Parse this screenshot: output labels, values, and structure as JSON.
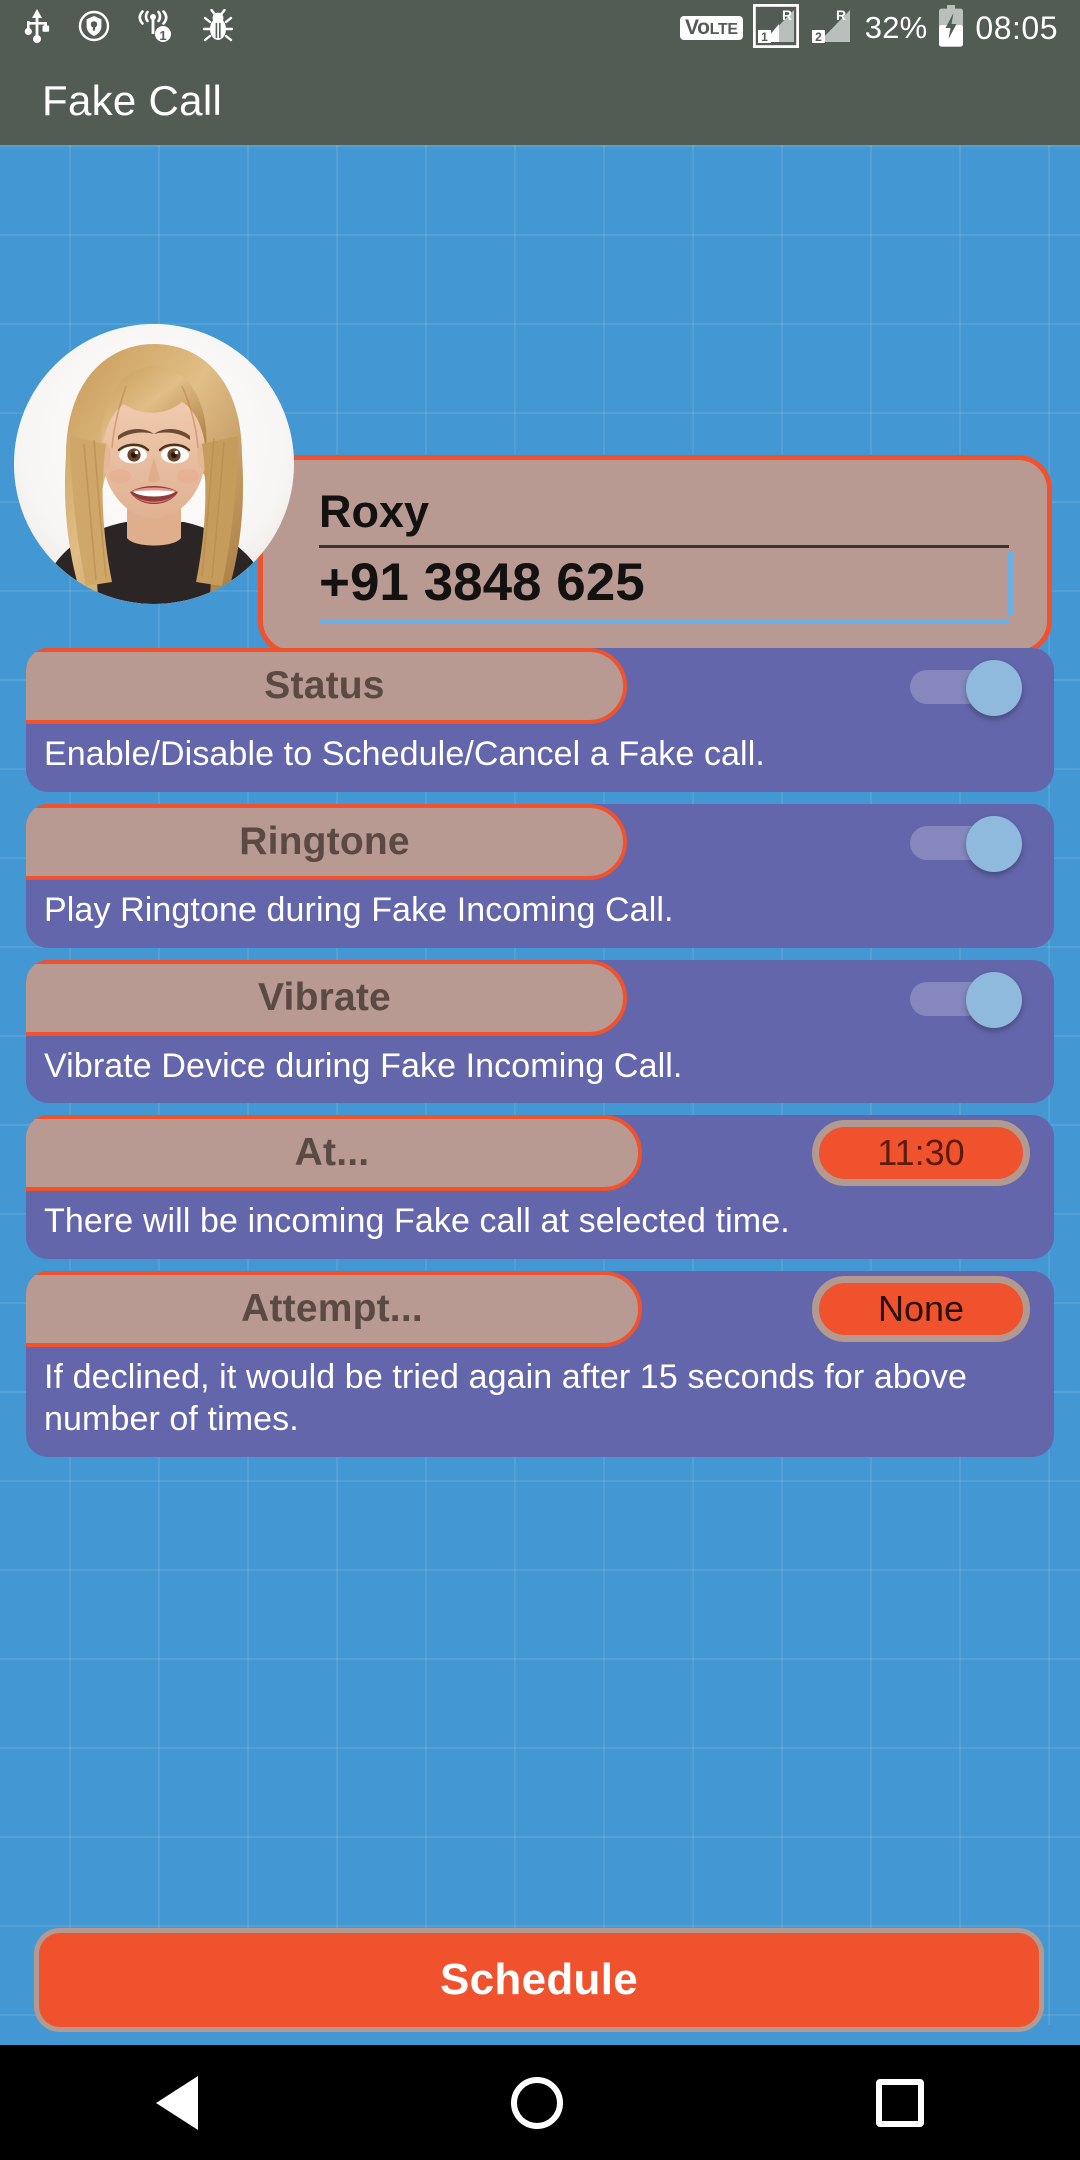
{
  "statusbar": {
    "icons_left": [
      "usb-icon",
      "shield-location-icon",
      "hotspot-sim1-icon",
      "bug-icon"
    ],
    "volte_label": "VoLTE",
    "volte_prefix": "Vo",
    "volte_suffix": "LTE",
    "sim1_label": "1",
    "sim1_roaming": "R",
    "sim2_label": "2",
    "sim2_roaming": "R",
    "battery_percent": "32%",
    "battery_state": "charging",
    "time": "08:05"
  },
  "appbar": {
    "title": "Fake Call"
  },
  "contact": {
    "avatar_name": "contact-photo",
    "name_value": "Roxy",
    "phone_value": "+91 3848 625",
    "phone_focused": true
  },
  "settings": [
    {
      "label": "Status",
      "description": "Enable/Disable to Schedule/Cancel a Fake call.",
      "control": "toggle",
      "toggle_on": true,
      "name": "status"
    },
    {
      "label": "Ringtone",
      "description": "Play Ringtone during Fake Incoming Call.",
      "control": "toggle",
      "toggle_on": true,
      "name": "ringtone"
    },
    {
      "label": "Vibrate",
      "description": "Vibrate Device during Fake Incoming Call.",
      "control": "toggle",
      "toggle_on": true,
      "name": "vibrate"
    },
    {
      "label": "At...",
      "description": "There will be incoming Fake call at selected time.",
      "control": "chip",
      "chip_value": "11:30",
      "name": "at-time"
    },
    {
      "label": "Attempt...",
      "description": "If declined, it would be tried again after 15 seconds for above number of times.",
      "control": "chip",
      "chip_value": "None",
      "name": "attempt-count"
    }
  ],
  "schedule_button": {
    "label": "Schedule"
  },
  "navbar": {
    "back": "back-triangle-icon",
    "home": "home-circle-icon",
    "recents": "recents-square-icon"
  },
  "colors": {
    "accent_orange": "#f0522e",
    "row_purple": "#6366ab",
    "pill_tan": "#b89a92",
    "page_blue": "#4397d3",
    "bar_grey": "#525c55",
    "toggle_thumb": "#8fb9dd"
  }
}
